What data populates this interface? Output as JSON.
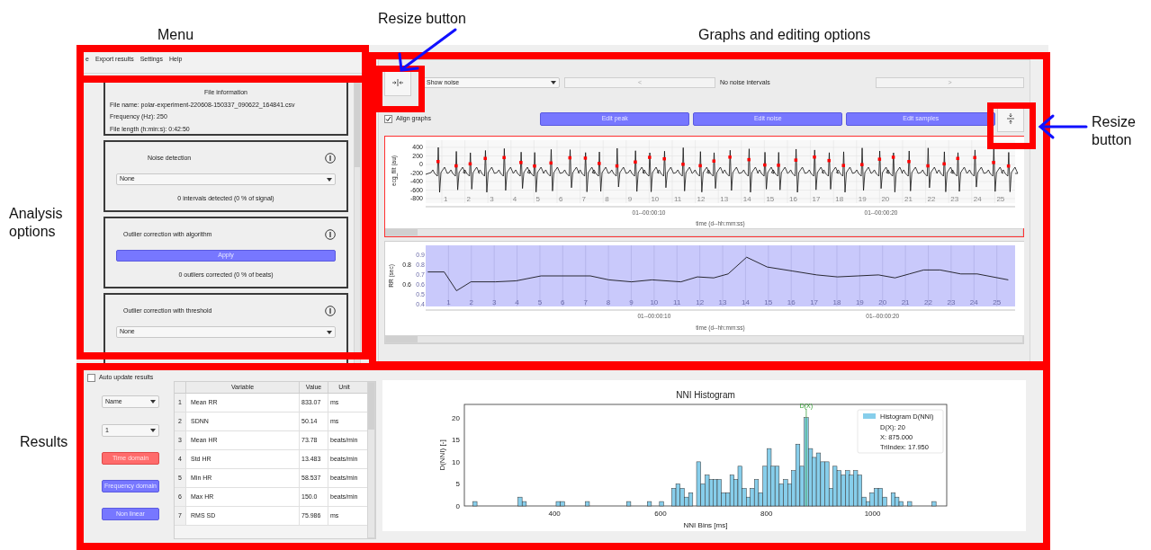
{
  "annotations": [
    {
      "text": "Menu"
    },
    {
      "text": "Resize button"
    },
    {
      "text": "Graphs and editing options"
    },
    {
      "text": "Analysis options"
    },
    {
      "text": "Results"
    },
    {
      "text": "Resize button"
    }
  ],
  "menu_bar": {
    "items": [
      "e",
      "Export results",
      "Settings",
      "Help"
    ]
  },
  "analysis_panel": {
    "file_info": {
      "title": "File information",
      "lines": [
        "File name: polar-experiment-220608-150337_090622_164841.csv",
        "Frequency (Hz): 250",
        "File length (h:min:s): 0:42:50"
      ]
    },
    "sections": [
      {
        "kind": "select",
        "title": "Noise detection",
        "select": "None",
        "status": "0 intervals detected (0 % of signal)"
      },
      {
        "kind": "button",
        "title": "Outlier correction with algorithm",
        "button": "Apply",
        "status": "0 outliers corrected (0 % of beats)"
      },
      {
        "kind": "select",
        "title": "Outlier correction with threshold",
        "select": "None"
      }
    ]
  },
  "graph_panel": {
    "noise_select": "Show noise",
    "prev_button": {
      "label": "<",
      "disabled": true
    },
    "noise_label": "No noise intervals",
    "next_button": {
      "label": ">",
      "disabled": true
    },
    "align_graphs": {
      "label": "Align graphs",
      "checked": true
    },
    "edit_buttons": [
      "Edit peak",
      "Edit noise",
      "Edit samples"
    ],
    "ecg_plot": {
      "selected": true,
      "ylabel": "ecg_filt (au)",
      "yticks": [
        "400",
        "200",
        "0",
        "-200",
        "-400",
        "-600",
        "-800"
      ],
      "xticks": [
        "01--00:00:10",
        "01--00:00:20"
      ],
      "xlabel": "time (d--hh:mm:ss)",
      "grid_labels": [
        "1",
        "2",
        "3",
        "4",
        "5",
        "6",
        "7",
        "8",
        "9",
        "10",
        "11",
        "12",
        "13",
        "14",
        "15",
        "16",
        "17",
        "18",
        "19",
        "20",
        "21",
        "22",
        "23",
        "24",
        "25"
      ]
    },
    "rr_plot": {
      "selected": false,
      "ghost_yticks": [
        "0.9",
        "0.8",
        "0.7",
        "0.6",
        "0.5",
        "0.4"
      ],
      "time_labels": [
        "01--00:00:10",
        "01--00:00:20"
      ],
      "chart_data": {
        "type": "line",
        "grid": true,
        "xlabel": "time (d--hh:mm:ss)",
        "ylabel": "RR (sec)",
        "xlim": [
          0,
          25.8
        ],
        "ylim": [
          0.38,
          1.0
        ],
        "xticks": [
          1,
          2,
          3,
          4,
          5,
          6,
          7,
          8,
          9,
          10,
          11,
          12,
          13,
          14,
          15,
          16,
          17,
          18,
          19,
          20,
          21,
          22,
          23,
          24,
          25
        ],
        "yticks": [
          {
            "value": 0.6,
            "label": "0.6"
          },
          {
            "value": 0.8,
            "label": "0.8"
          }
        ],
        "x": [
          0.09,
          0.81,
          1.35,
          1.98,
          3.06,
          3.96,
          5.05,
          7.21,
          8.02,
          9.01,
          9.91,
          11.17,
          11.89,
          12.61,
          13.24,
          14.05,
          14.95,
          16.04,
          17.12,
          18.02,
          18.92,
          19.82,
          20.54,
          21.17,
          21.8,
          22.52,
          23.42,
          24.14,
          25.5
        ],
        "series": [
          {
            "color": "#000000",
            "values": [
              0.73,
              0.73,
              0.54,
              0.63,
              0.63,
              0.64,
              0.69,
              0.69,
              0.65,
              0.63,
              0.65,
              0.63,
              0.68,
              0.67,
              0.71,
              0.88,
              0.78,
              0.74,
              0.7,
              0.68,
              0.69,
              0.7,
              0.67,
              0.71,
              0.75,
              0.75,
              0.71,
              0.71,
              0.65
            ]
          }
        ]
      }
    }
  },
  "results": {
    "auto_update": {
      "label": "Auto update results",
      "checked": false
    },
    "selects": [
      "Name",
      "1"
    ],
    "domain_buttons": [
      {
        "label": "Time domain",
        "selected": true
      },
      {
        "label": "Frequency domain",
        "selected": false
      },
      {
        "label": "Non linear",
        "selected": false
      }
    ],
    "table": {
      "columns": [
        "Variable",
        "Value",
        "Unit"
      ],
      "rows": [
        {
          "index": "1",
          "variable": "Mean RR",
          "value": "833.07",
          "unit": "ms"
        },
        {
          "index": "2",
          "variable": "SDNN",
          "value": "50.14",
          "unit": "ms"
        },
        {
          "index": "3",
          "variable": "Mean HR",
          "value": "73.78",
          "unit": "beats/min"
        },
        {
          "index": "4",
          "variable": "Std HR",
          "value": "13.483",
          "unit": "beats/min"
        },
        {
          "index": "5",
          "variable": "Min HR",
          "value": "58.537",
          "unit": "beats/min"
        },
        {
          "index": "6",
          "variable": "Max HR",
          "value": "150.0",
          "unit": "beats/min"
        },
        {
          "index": "7",
          "variable": "RMS SD",
          "value": "75.986",
          "unit": "ms"
        }
      ]
    },
    "histogram": {
      "legend": [
        "D(X): 20",
        "X: 875.000",
        "TriIndex: 17.950"
      ],
      "chart_data": {
        "type": "bar",
        "title": "NNI Histogram",
        "xlabel": "NNI Bins [ms]",
        "ylabel": "D(NNI) [-]",
        "xlim": [
          230,
          1140
        ],
        "ylim": [
          0,
          23
        ],
        "xticks": [
          400,
          600,
          800,
          1000
        ],
        "yticks": [
          0,
          5,
          10,
          15,
          20
        ],
        "ref_lines": [
          {
            "axis": "x",
            "value": 875,
            "label": "D(X)",
            "color": "#2a9a2a"
          }
        ],
        "x": [
          250,
          335,
          343,
          407,
          415,
          462,
          540,
          579,
          602,
          625,
          633,
          641,
          649,
          657,
          672,
          680,
          688,
          696,
          703,
          711,
          719,
          727,
          735,
          742,
          750,
          758,
          766,
          773,
          781,
          789,
          797,
          805,
          812,
          820,
          828,
          836,
          844,
          851,
          859,
          867,
          875,
          883,
          890,
          898,
          906,
          914,
          922,
          929,
          937,
          945,
          953,
          960,
          968,
          976,
          984,
          992,
          999,
          1007,
          1015,
          1023,
          1039,
          1046,
          1054,
          1070,
          1116
        ],
        "series": [
          {
            "name": "Histogram D(NNI)",
            "color": "#87ceeb",
            "values": [
              1,
              2,
              1,
              1,
              1,
              1,
              1,
              1,
              1,
              4,
              5,
              4,
              2,
              3,
              10,
              5,
              7,
              6,
              6,
              6,
              3,
              3,
              7,
              6,
              9,
              4,
              2,
              4,
              6,
              3,
              9,
              13,
              9,
              9,
              5,
              6,
              5,
              8,
              14,
              9,
              20,
              13,
              11,
              12,
              10,
              10,
              4,
              9,
              8,
              7,
              8,
              7,
              8,
              7,
              2,
              1,
              3,
              4,
              4,
              2,
              3,
              2,
              1,
              1,
              1
            ]
          }
        ]
      }
    }
  }
}
